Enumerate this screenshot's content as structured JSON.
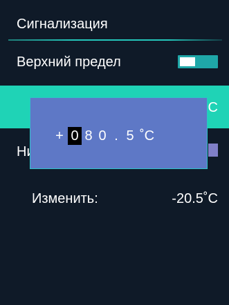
{
  "screen": {
    "title": "Сигнализация"
  },
  "rows": {
    "upper": {
      "label": "Верхний предел",
      "toggle_on": true
    },
    "selected": {
      "unit": "C"
    },
    "lower": {
      "label": "Ни",
      "toggle_on": false
    },
    "change": {
      "label": "Изменить:",
      "value": "-20.5˚C"
    }
  },
  "popup": {
    "sign": "+",
    "digits": [
      "0",
      "8",
      "0",
      ".",
      "5"
    ],
    "selected_index": 0,
    "unit": "˚C"
  },
  "colors": {
    "background": "#0f1a28",
    "accent": "#1fd3b6",
    "toggle_on": "#1fa7a8",
    "popup_bg": "#5e78c6",
    "popup_border": "#2ec3c9",
    "toggle_off": "#8080c8"
  }
}
